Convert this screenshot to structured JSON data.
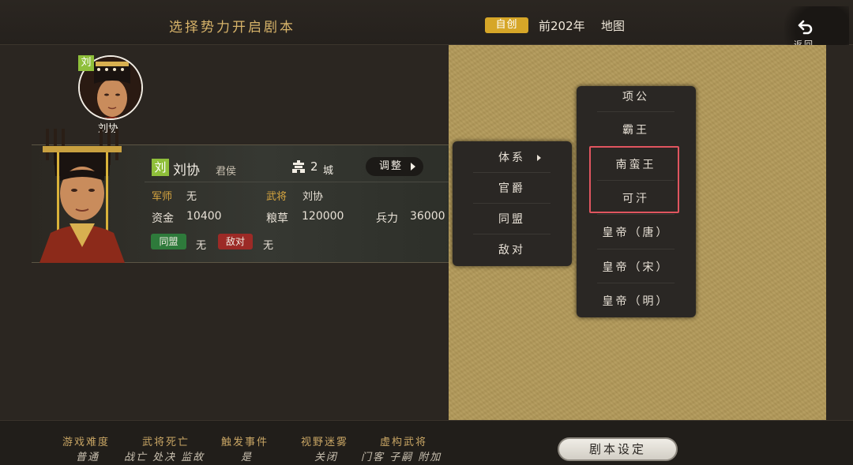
{
  "header": {
    "title": "选择势力开启剧本",
    "mode_badge": "自创",
    "year": "前202年",
    "map_label": "地图",
    "back_label": "返回"
  },
  "selected_ruler": {
    "avatar_tag": "刘",
    "avatar_name": "刘协",
    "faction_tag": "刘",
    "name": "刘协",
    "title": "君侯",
    "city_count": "2",
    "city_unit": "城",
    "adjust_label": "调整"
  },
  "stats": {
    "advisor_label": "军师",
    "advisor_value": "无",
    "general_label": "武将",
    "general_value": "刘协",
    "funds_label": "资金",
    "funds_value": "10400",
    "food_label": "粮草",
    "food_value": "120000",
    "troops_label": "兵力",
    "troops_value": "36000",
    "alliance_label": "同盟",
    "alliance_value": "无",
    "hostile_label": "敌对",
    "hostile_value": "无"
  },
  "context_menu": {
    "items": [
      "体系",
      "官爵",
      "同盟",
      "敌对"
    ]
  },
  "system_submenu": {
    "items": [
      "项公",
      "霸王",
      "南蛮王",
      "可汗",
      "皇帝（唐）",
      "皇帝（宋）",
      "皇帝（明）"
    ],
    "highlighted": [
      "南蛮王",
      "可汗"
    ]
  },
  "footer": {
    "settings": [
      {
        "label": "游戏难度",
        "value": "普通"
      },
      {
        "label": "武将死亡",
        "value": "战亡 处决 监故"
      },
      {
        "label": "触发事件",
        "value": "是"
      },
      {
        "label": "视野迷雾",
        "value": "关闭"
      },
      {
        "label": "虚构武将",
        "value": "门客 子嗣 附加"
      }
    ],
    "scenario_button": "剧本设定"
  },
  "colors": {
    "accent_gold": "#d6a628",
    "faction_green": "#8fbf3a",
    "alliance_green": "#2e7a3b",
    "hostile_red": "#9c2a26",
    "highlight_red": "#e0555f",
    "map_tan": "#b39a5a"
  }
}
